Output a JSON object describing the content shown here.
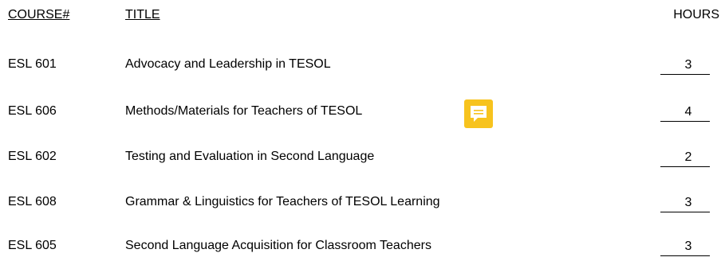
{
  "header": {
    "course": "COURSE#",
    "title": "TITLE",
    "hours": "HOURS"
  },
  "courses": [
    {
      "code": "ESL 601",
      "title": "Advocacy and Leadership in TESOL",
      "hours": "3"
    },
    {
      "code": "ESL 606",
      "title": "Methods/Materials for Teachers of TESOL",
      "hours": "4"
    },
    {
      "code": "ESL 602",
      "title": "Testing and Evaluation in Second Language",
      "hours": "2"
    },
    {
      "code": "ESL 608",
      "title": "Grammar & Linguistics for Teachers of TESOL Learning",
      "hours": "3"
    },
    {
      "code": "ESL 605",
      "title": "Second Language Acquisition for Classroom Teachers",
      "hours": "3"
    }
  ],
  "comment_icon": {
    "icon": "comment-icon",
    "color": "#F7C31E"
  }
}
